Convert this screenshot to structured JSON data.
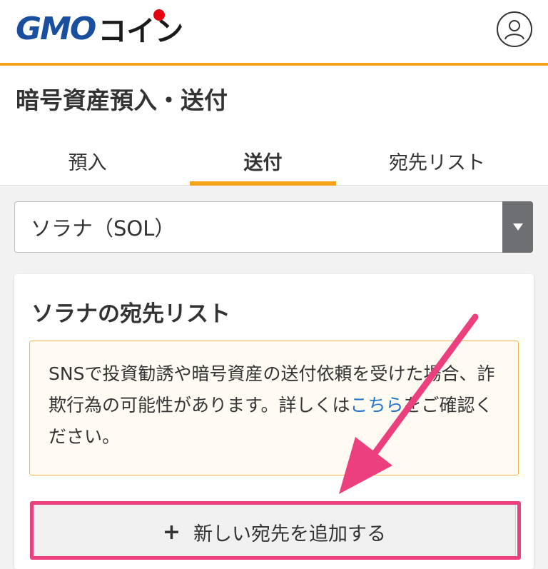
{
  "header": {
    "logo_gmo": "GMO",
    "logo_coin": "コイン",
    "user_icon": "user-circle-icon",
    "accent_color": "#f5a21c"
  },
  "page": {
    "title": "暗号資産預入・送付"
  },
  "tabs": [
    {
      "label": "預入",
      "active": false
    },
    {
      "label": "送付",
      "active": true
    },
    {
      "label": "宛先リスト",
      "active": false
    }
  ],
  "currency_select": {
    "selected": "ソラナ（SOL）",
    "arrow_icon": "caret-down-icon"
  },
  "card": {
    "title": "ソラナの宛先リスト",
    "warning": {
      "text_before": "SNSで投資勧誘や暗号資産の送付依頼を受けた場合、詐欺行為の可能性があります。詳しくは",
      "link": "こちら",
      "text_after": "をご確認ください。"
    },
    "add_button": {
      "icon": "plus-icon",
      "label": "新しい宛先を追加する"
    }
  },
  "annotation": {
    "color": "#ec3f7d"
  }
}
